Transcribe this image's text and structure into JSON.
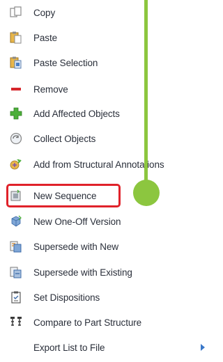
{
  "menu": {
    "items": [
      {
        "label": "Copy",
        "icon": "copy-icon"
      },
      {
        "label": "Paste",
        "icon": "paste-icon"
      },
      {
        "label": "Paste Selection",
        "icon": "paste-selection-icon"
      },
      {
        "label": "Remove",
        "icon": "remove-icon"
      },
      {
        "label": "Add Affected Objects",
        "icon": "add-icon"
      },
      {
        "label": "Collect Objects",
        "icon": "collect-objects-icon"
      },
      {
        "label": "Add from Structural Annotations",
        "icon": "structural-annotations-icon"
      },
      {
        "label": "New Sequence",
        "icon": "new-sequence-icon"
      },
      {
        "label": "New One-Off Version",
        "icon": "one-off-version-icon"
      },
      {
        "label": "Supersede with New",
        "icon": "supersede-new-icon"
      },
      {
        "label": "Supersede with Existing",
        "icon": "supersede-existing-icon"
      },
      {
        "label": "Set Dispositions",
        "icon": "set-dispositions-icon"
      },
      {
        "label": "Compare to Part Structure",
        "icon": "compare-structure-icon"
      },
      {
        "label": "Export List to File",
        "icon": "submenu-arrow-icon"
      }
    ]
  },
  "colors": {
    "highlight": "#e0222a",
    "pointer": "#8cc63f",
    "text": "#2a2f3a"
  }
}
